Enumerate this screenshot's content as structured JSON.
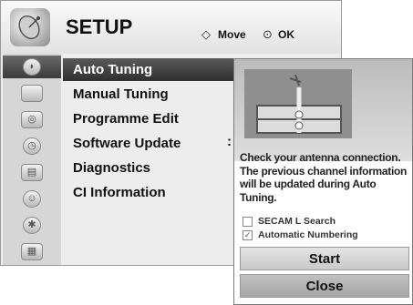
{
  "header": {
    "title": "SETUP",
    "hint_move": "Move",
    "hint_ok": "OK"
  },
  "sidebar": {
    "icons": [
      "satellite-icon",
      "tv-icon",
      "speaker-icon",
      "clock-icon",
      "lock-icon",
      "person-icon",
      "usb-icon",
      "media-icon"
    ]
  },
  "menu": {
    "items": [
      {
        "label": "Auto Tuning"
      },
      {
        "label": "Manual Tuning"
      },
      {
        "label": "Programme Edit"
      },
      {
        "label": "Software Update"
      },
      {
        "label": "Diagnostics"
      },
      {
        "label": "CI Information"
      }
    ],
    "software_update_value": ":"
  },
  "popup": {
    "description": "Check your antenna connection. The previous channel information will be updated during Auto Tuning.",
    "options": [
      {
        "label": "SECAM L Search",
        "checked": false
      },
      {
        "label": "Automatic Numbering",
        "checked": true
      }
    ],
    "start_label": "Start",
    "close_label": "Close"
  }
}
